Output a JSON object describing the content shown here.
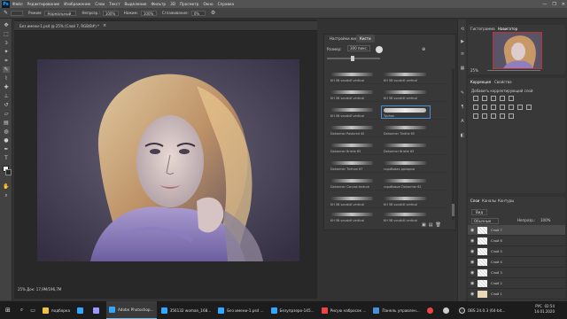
{
  "app": {
    "logo": "Ps"
  },
  "menu": [
    "Файл",
    "Редактирование",
    "Изображение",
    "Слои",
    "Текст",
    "Выделение",
    "Фильтр",
    "3D",
    "Просмотр",
    "Окно",
    "Справка"
  ],
  "window_controls": [
    "—",
    "❐",
    "✕"
  ],
  "options": {
    "mode_label": "Режим:",
    "mode_value": "Нормальный",
    "opacity_label": "Непрозр.:",
    "opacity_value": "100%",
    "flow_label": "Нажим:",
    "flow_value": "100%",
    "smooth_label": "Сглаживание:",
    "smooth_value": "0%"
  },
  "document": {
    "tab_title": "Без имени-1.psd @ 25% (Слой 7, RGB/8#) *",
    "close": "×",
    "status": "25%    Док: 17,9M/196,7M"
  },
  "brushes_panel": {
    "tabs": [
      "Настройки кисти",
      "Кисти"
    ],
    "size_label": "Размер:",
    "size_value": "300 пикс.",
    "rows": [
      [
        "KH 5B vocabili vertical",
        "KH 5B vocabili vertical"
      ],
      [
        "KH 5B vocabili vertical",
        "KH 5B vocabili vertical"
      ],
      [
        "KH 5B vocabili vertical",
        "Typhon"
      ],
      [
        "Daharmer Pastured 40",
        "Daharmer Tindhe 65"
      ],
      [
        "Daharmer Bristle 65",
        "Daharmer Bristle 65"
      ],
      [
        "Daharmer Tinfrom 67",
        "скрабовая дахарми"
      ],
      [
        "Daharmer Canvas texture",
        "скрабовые Daharmer 62"
      ],
      [
        "KH 5B vocabili vertical",
        "KH 5B vocabili vertical"
      ],
      [
        "KH 5B vocabili vertical",
        "KH 5B vocabili vertical"
      ]
    ]
  },
  "navigator": {
    "tab_a": "Гистограмма",
    "tab_b": "Навигатор",
    "zoom": "25%"
  },
  "adjustments": {
    "tab_a": "Коррекция",
    "tab_b": "Свойства",
    "add_label": "Добавить корректирующий слой"
  },
  "layers": {
    "tab_a": "Слои",
    "tab_b": "Каналы",
    "tab_c": "Контуры",
    "kind_label": "Вид",
    "blend_value": "Обычные",
    "opacity_label": "Непрозр.:",
    "opacity_value": "100%",
    "items": [
      "Слой 7",
      "Слой 6",
      "Слой 5",
      "Слой 4",
      "Слой 3",
      "Слой 2",
      "Слой 1"
    ]
  },
  "taskbar": {
    "items": [
      {
        "label": "подборка",
        "color": "#f0c040"
      },
      {
        "label": "",
        "color": "#31a8ff"
      },
      {
        "label": "",
        "color": "#9999ff"
      },
      {
        "label": "Adobe Photoshop...",
        "color": "#31a8ff"
      },
      {
        "label": "356132 woman_168...",
        "color": "#31a8ff"
      },
      {
        "label": "Без имени-1.psd ...",
        "color": "#31a8ff"
      },
      {
        "label": "Безупрзеро-145...",
        "color": "#31a8ff"
      },
      {
        "label": "Рисую набросок ...",
        "color": "#e44"
      },
      {
        "label": "Панель управлен...",
        "color": "#4a90d9"
      },
      {
        "label": "",
        "color": "#e44"
      },
      {
        "label": "",
        "color": "#ccc"
      }
    ],
    "tray": "OBS 24.0.3 (64-bit...",
    "lang": "РУС",
    "time": "02:54",
    "date": "14.01.2020"
  }
}
